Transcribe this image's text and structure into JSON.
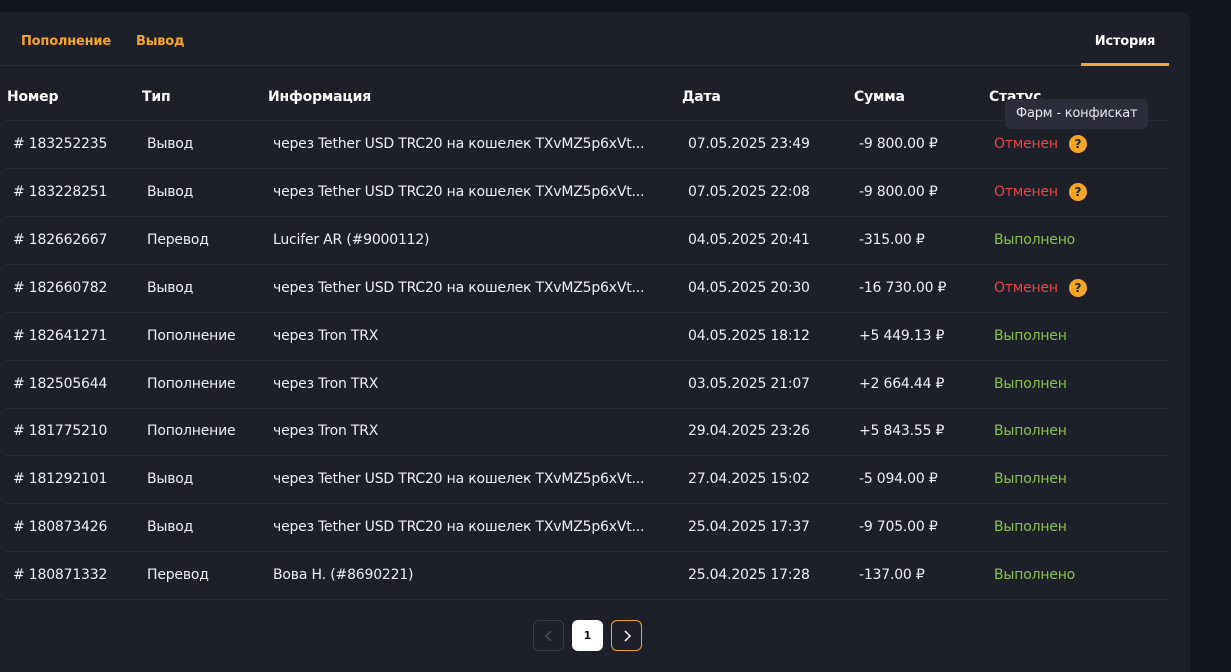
{
  "tabs": {
    "deposit": "Пополнение",
    "withdraw": "Вывод",
    "history": "История"
  },
  "table": {
    "headers": {
      "number": "Номер",
      "type": "Тип",
      "info": "Информация",
      "date": "Дата",
      "sum": "Сумма",
      "status": "Статус"
    },
    "rows": [
      {
        "number": "# 183252235",
        "type": "Вывод",
        "info": "через Tether USD TRC20 на кошелек TXvMZ5p6xVt...",
        "date": "07.05.2025 23:49",
        "sum": "-9 800.00 ₽",
        "status": "Отменен",
        "status_kind": "cancel",
        "has_info": true
      },
      {
        "number": "# 183228251",
        "type": "Вывод",
        "info": "через Tether USD TRC20 на кошелек TXvMZ5p6xVt...",
        "date": "07.05.2025 22:08",
        "sum": "-9 800.00 ₽",
        "status": "Отменен",
        "status_kind": "cancel",
        "has_info": true
      },
      {
        "number": "# 182662667",
        "type": "Перевод",
        "info": "Lucifer AR (#9000112)",
        "date": "04.05.2025 20:41",
        "sum": "-315.00 ₽",
        "status": "Выполнено",
        "status_kind": "done",
        "has_info": false
      },
      {
        "number": "# 182660782",
        "type": "Вывод",
        "info": "через Tether USD TRC20 на кошелек TXvMZ5p6xVt...",
        "date": "04.05.2025 20:30",
        "sum": "-16 730.00 ₽",
        "status": "Отменен",
        "status_kind": "cancel",
        "has_info": true
      },
      {
        "number": "# 182641271",
        "type": "Пополнение",
        "info": "через Tron TRX",
        "date": "04.05.2025 18:12",
        "sum": "+5 449.13 ₽",
        "status": "Выполнен",
        "status_kind": "done",
        "has_info": false
      },
      {
        "number": "# 182505644",
        "type": "Пополнение",
        "info": "через Tron TRX",
        "date": "03.05.2025 21:07",
        "sum": "+2 664.44 ₽",
        "status": "Выполнен",
        "status_kind": "done",
        "has_info": false
      },
      {
        "number": "# 181775210",
        "type": "Пополнение",
        "info": "через Tron TRX",
        "date": "29.04.2025 23:26",
        "sum": "+5 843.55 ₽",
        "status": "Выполнен",
        "status_kind": "done",
        "has_info": false
      },
      {
        "number": "# 181292101",
        "type": "Вывод",
        "info": "через Tether USD TRC20 на кошелек TXvMZ5p6xVt...",
        "date": "27.04.2025 15:02",
        "sum": "-5 094.00 ₽",
        "status": "Выполнен",
        "status_kind": "done",
        "has_info": false
      },
      {
        "number": "# 180873426",
        "type": "Вывод",
        "info": "через Tether USD TRC20 на кошелек TXvMZ5p6xVt...",
        "date": "25.04.2025 17:37",
        "sum": "-9 705.00 ₽",
        "status": "Выполнен",
        "status_kind": "done",
        "has_info": false
      },
      {
        "number": "# 180871332",
        "type": "Перевод",
        "info": "Вова Н. (#8690221)",
        "date": "25.04.2025 17:28",
        "sum": "-137.00 ₽",
        "status": "Выполнено",
        "status_kind": "done",
        "has_info": false
      }
    ]
  },
  "tooltip": "Фарм - конфискат",
  "info_icon": "?",
  "pagination": {
    "current_page": "1"
  },
  "colors": {
    "accent": "#f5a623",
    "cancelled": "#e5484d",
    "completed": "#8bc34a",
    "panel": "#1d1f29",
    "background": "#14161d"
  },
  "icons": {
    "info": "question-icon",
    "prev": "chevron-left-icon",
    "next": "chevron-right-icon"
  }
}
